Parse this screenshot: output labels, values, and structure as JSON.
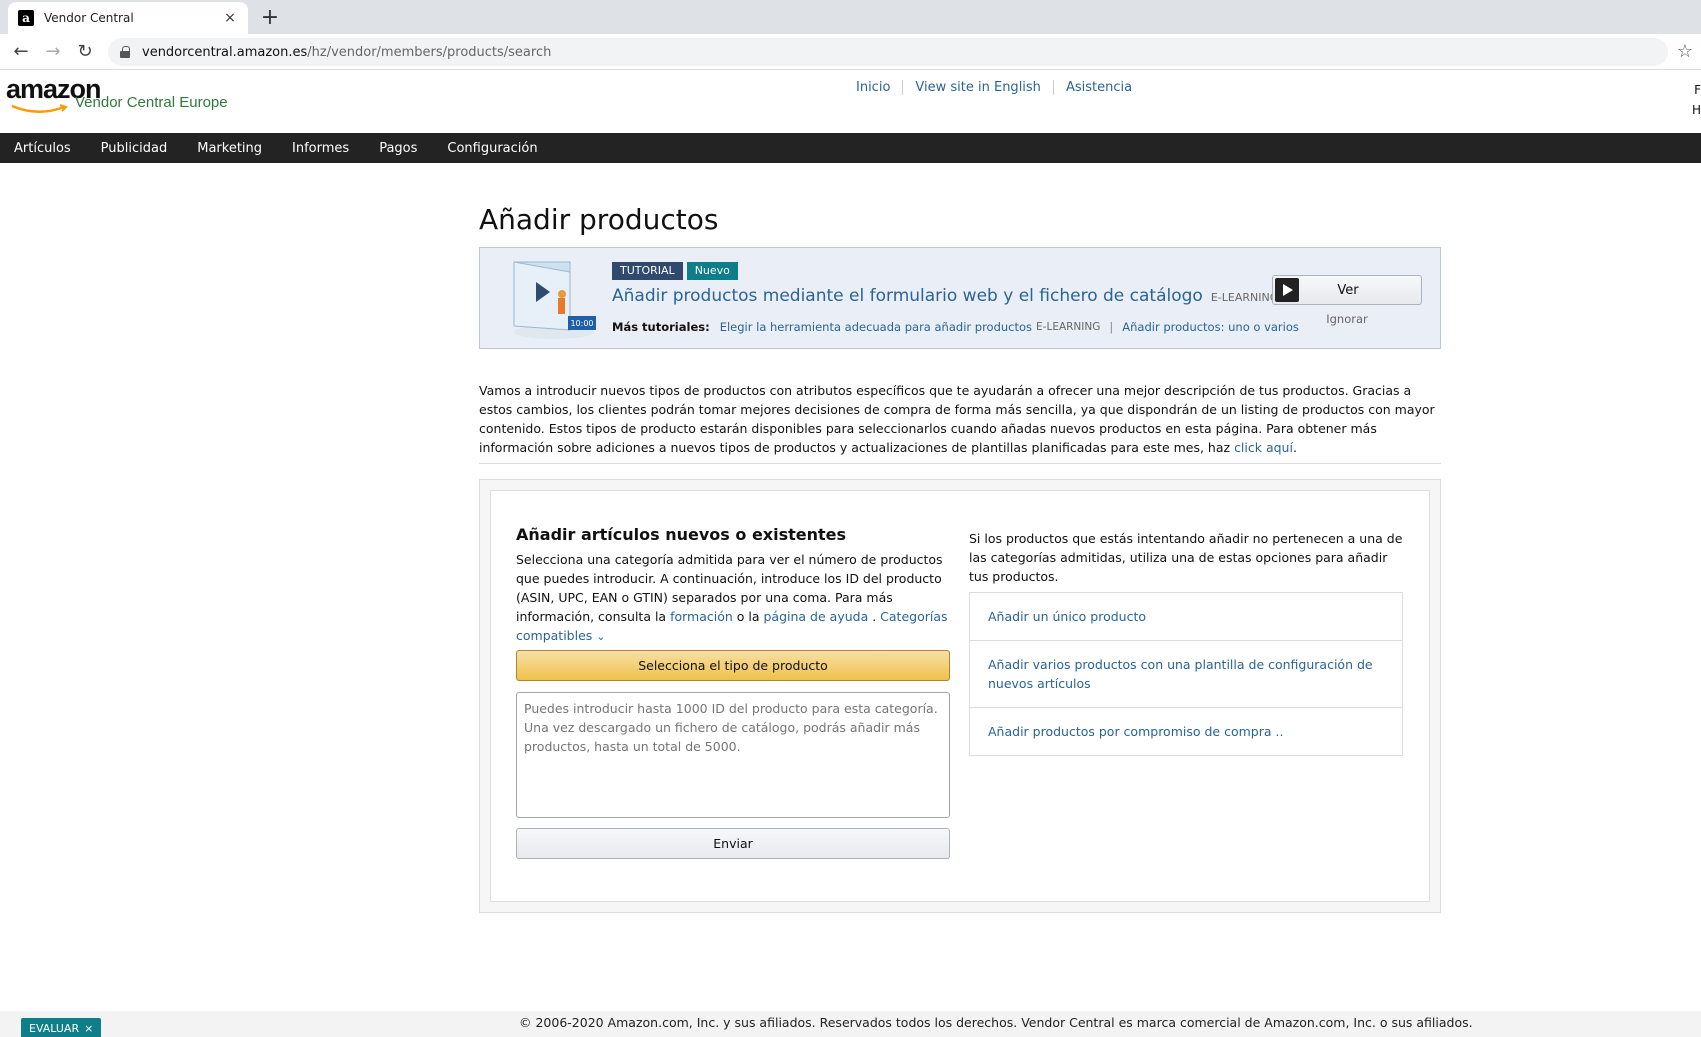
{
  "browser": {
    "tab_title": "Vendor Central",
    "tab_close": "×",
    "new_tab": "+",
    "url_host": "vendorcentral.amazon.es",
    "url_path": "/hz/vendor/members/products/search",
    "back_icon": "←",
    "forward_icon": "→",
    "reload_icon": "↻",
    "star_icon": "☆",
    "favicon_letter": "a"
  },
  "header": {
    "logo_word": "amazon",
    "logo_sub": "Vendor Central Europe",
    "links": [
      "Inicio",
      "View site in English",
      "Asistencia"
    ],
    "edge_line1": "F",
    "edge_line2": "H"
  },
  "nav": {
    "items": [
      "Artículos",
      "Publicidad",
      "Marketing",
      "Informes",
      "Pagos",
      "Configuración"
    ]
  },
  "page": {
    "title": "Añadir productos"
  },
  "tutorial": {
    "badge_tutorial": "TUTORIAL",
    "badge_new": "Nuevo",
    "duration": "10:00",
    "title": "Añadir productos mediante el formulario web y el fichero de catálogo",
    "title_tag": "E-LEARNING",
    "more_label": "Más tutoriales:",
    "more_link1": "Elegir la herramienta adecuada para añadir productos",
    "more_link1_tag": "E-LEARNING",
    "more_sep": "|",
    "more_link2": "Añadir productos: uno o varios",
    "watch_button": "Ver",
    "ignore": "Ignorar"
  },
  "intro": {
    "text": "Vamos a introducir nuevos tipos de productos con atributos específicos que te ayudarán a ofrecer una mejor descripción de tus productos. Gracias a estos cambios, los clientes podrán tomar mejores decisiones de compra de forma más sencilla, ya que dispondrán de un listing de productos con mayor contenido. Estos tipos de producto estarán disponibles para seleccionarlos cuando añadas nuevos productos en esta página. Para obtener más información sobre adiciones a nuevos tipos de productos y actualizaciones de plantillas planificadas para este mes, haz ",
    "link": "click aquí",
    "end": "."
  },
  "add_section": {
    "title": "Añadir artículos nuevos o existentes",
    "desc_part1": "Selecciona una categoría admitida para ver el número de productos que puedes introducir. A continuación, introduce los ID del producto (ASIN, UPC, EAN o GTIN) separados por una coma. Para más información, consulta la ",
    "link_training": "formación",
    "desc_part2": " o la ",
    "link_help": "página de ayuda",
    "desc_part3": " . ",
    "link_categories": "Categorías compatibles",
    "chevron": "⌄",
    "select_button": "Selecciona el tipo de producto",
    "textarea_placeholder": "Puedes introducir hasta 1000 ID del producto para esta categoría. Una vez descargado un fichero de catálogo, podrás añadir más productos, hasta un total de 5000.",
    "submit_button": "Enviar"
  },
  "options": {
    "desc": "Si los productos que estás intentando añadir no pertenecen a una de las categorías admitidas, utiliza una de estas opciones para añadir tus productos.",
    "items": [
      "Añadir un único producto",
      "Añadir varios productos con una plantilla de configuración de nuevos artículos",
      "Añadir productos por compromiso de compra .."
    ]
  },
  "footer": {
    "copyright": "© 2006-2020 Amazon.com, Inc. y sus afiliados. Reservados todos los derechos. Vendor Central es marca comercial de Amazon.com, Inc. o sus afiliados.",
    "evaluate": "EVALUAR",
    "evaluate_close": "×"
  },
  "colors": {
    "link": "#2a6496",
    "nav_bg": "#232323",
    "button_yellow": "#f0c14b",
    "badge_teal": "#0d7e8a",
    "badge_navy": "#2f4a6d"
  }
}
